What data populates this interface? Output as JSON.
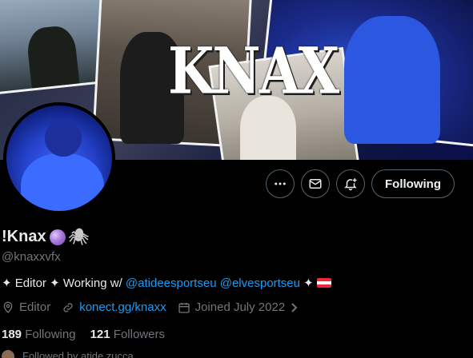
{
  "banner": {
    "brand_text": "KNAX"
  },
  "actions": {
    "more_icon": "more-icon",
    "message_icon": "mail-icon",
    "notify_icon": "bell-plus-icon",
    "follow_label": "Following"
  },
  "profile": {
    "display_name": "!Knax",
    "handle": "@knaxxvfx",
    "bio": {
      "prefix": "✦ Editor ✦ Working w/ ",
      "mention1": "@atideesportseu",
      "mention2": "@elvesportseu",
      "suffix": " ✦ "
    },
    "location": "Editor",
    "link": "konect.gg/knaxx",
    "joined": "Joined July 2022"
  },
  "stats": {
    "following_count": "189",
    "following_label": "Following",
    "followers_count": "121",
    "followers_label": "Followers"
  },
  "followed_by": "Followed by atide.zucca..",
  "colors": {
    "accent": "#1d9bf0",
    "muted": "#71767b",
    "text": "#e7e9ea",
    "border": "#536471"
  }
}
